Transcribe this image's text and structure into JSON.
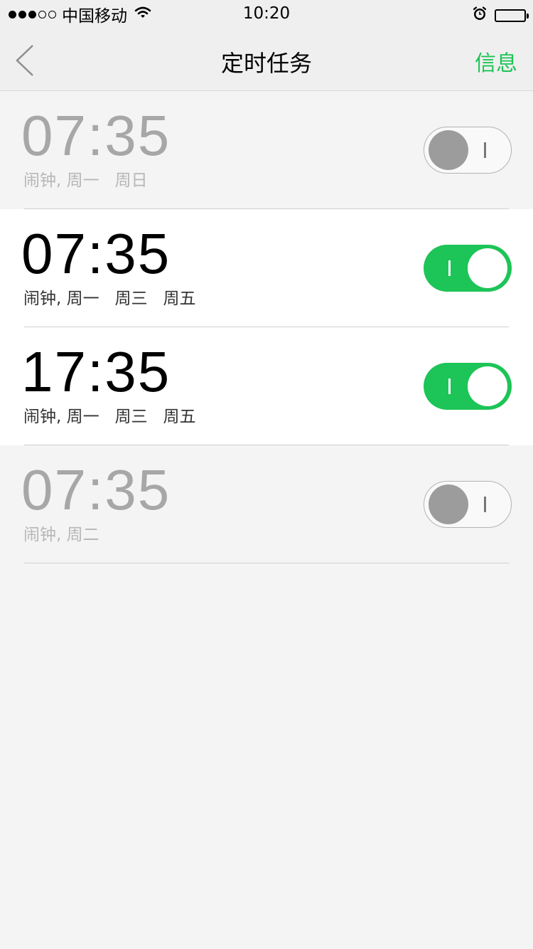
{
  "status_bar": {
    "carrier": "中国移动",
    "time": "10:20",
    "signal_dots": [
      true,
      true,
      true,
      false,
      false
    ]
  },
  "nav": {
    "title": "定时任务",
    "right_action": "信息"
  },
  "colors": {
    "accent": "#1ec456",
    "toggle_on": "#1dc457",
    "toggle_off_knob": "#9c9c9c"
  },
  "alarms": [
    {
      "time": "07:35",
      "label": "闹钟, 周一   周日",
      "enabled": false
    },
    {
      "time": "07:35",
      "label": "闹钟, 周一   周三   周五",
      "enabled": true
    },
    {
      "time": "17:35",
      "label": "闹钟, 周一   周三   周五",
      "enabled": true
    },
    {
      "time": "07:35",
      "label": "闹钟, 周二",
      "enabled": false
    }
  ]
}
